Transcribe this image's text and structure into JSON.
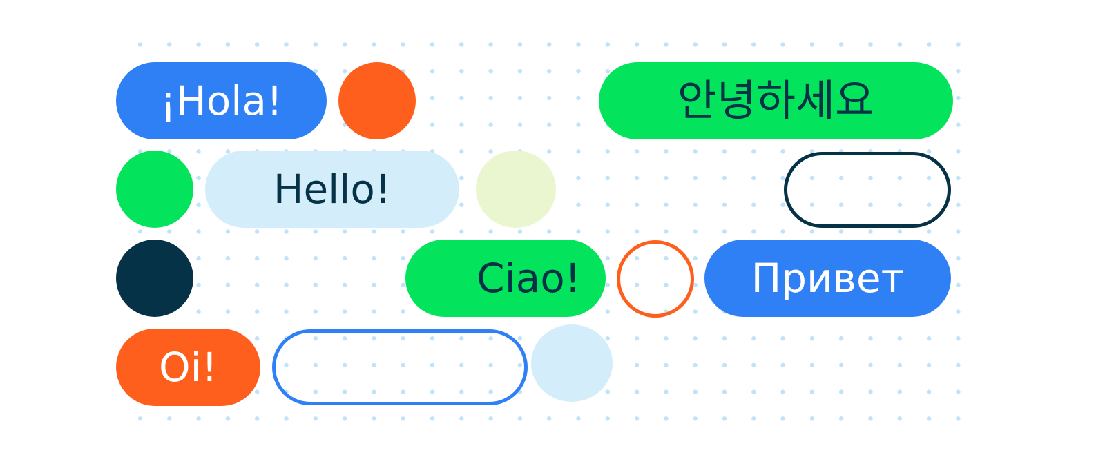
{
  "colors": {
    "blue": "#2f80f5",
    "orange": "#ff5f1c",
    "green": "#04e35c",
    "navy": "#063247",
    "light_blue": "#d3edfb",
    "pale_green": "#e9f6cf",
    "white": "#ffffff",
    "dot": "#bfe3f8"
  },
  "greetings": {
    "spanish": "¡Hola!",
    "korean": "안녕하세요",
    "english": "Hello!",
    "italian": "Ciao!",
    "russian": "Привет",
    "portuguese": "Oi!"
  }
}
